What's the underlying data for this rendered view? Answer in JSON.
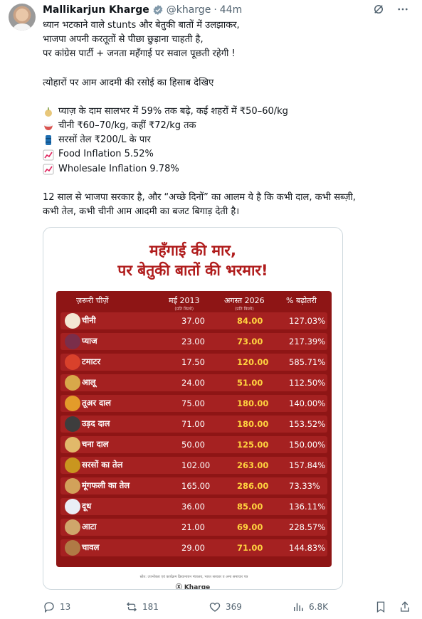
{
  "author": {
    "name": "Mallikarjun Kharge",
    "handle": "@kharge",
    "dot": "·",
    "time": "44m"
  },
  "text": {
    "l1": "ध्यान भटकाने वाले stunts और बेतुकी बातों में उलझाकर,",
    "l2": "भाजपा अपनी करतूतों से पीछा छुड़ाना चाहती है,",
    "l3": "पर कांग्रेस पार्टी + जनता महँगाई पर सवाल पूछती रहेगी !",
    "l4": "त्योहारों पर आम आदमी की रसोई का हिसाब देखिए",
    "b1": "प्याज़ के दाम सालभर में 59% तक बढ़े, कई शहरों में ₹50–60/kg",
    "b2": "चीनी ₹60–70/kg, कहीं ₹72/kg तक",
    "b3": "सरसों तेल ₹200/L के पार",
    "b4": "Food Inflation 5.52%",
    "b5": "Wholesale Inflation 9.78%",
    "l5": "12 साल से भाजपा सरकार है, और “अच्छे दिनों” का आलम ये है कि कभी दाल, कभी सब्ज़ी,",
    "l6": "कभी तेल, कभी चीनी आम आदमी का बजट बिगाड़ देती है।"
  },
  "poster": {
    "title1": "महँगाई की मार,",
    "title2": "पर बेतुकी बातों की भरमार!",
    "headers": {
      "item": "ज़रूरी चीज़ें",
      "may2013": "मई 2013",
      "aug2026": "अगस्त 2026",
      "sub": "(प्रति किलो)",
      "increase": "% बढ़ोतरी"
    },
    "rows": [
      {
        "item": "चीनी",
        "a": "37.00",
        "b": "84.00",
        "c": "127.03%"
      },
      {
        "item": "प्याज",
        "a": "23.00",
        "b": "73.00",
        "c": "217.39%"
      },
      {
        "item": "टमाटर",
        "a": "17.50",
        "b": "120.00",
        "c": "585.71%"
      },
      {
        "item": "आलू",
        "a": "24.00",
        "b": "51.00",
        "c": "112.50%"
      },
      {
        "item": "तूअर दाल",
        "a": "75.00",
        "b": "180.00",
        "c": "140.00%"
      },
      {
        "item": "उड़द दाल",
        "a": "71.00",
        "b": "180.00",
        "c": "153.52%"
      },
      {
        "item": "चना दाल",
        "a": "50.00",
        "b": "125.00",
        "c": "150.00%"
      },
      {
        "item": "सरसों का तेल",
        "a": "102.00",
        "b": "263.00",
        "c": "157.84%"
      },
      {
        "item": "मूंगफली का तेल",
        "a": "165.00",
        "b": "286.00",
        "c": "73.33%"
      },
      {
        "item": "दूध",
        "a": "36.00",
        "b": "85.00",
        "c": "136.11%"
      },
      {
        "item": "आटा",
        "a": "21.00",
        "b": "69.00",
        "c": "228.57%"
      },
      {
        "item": "चावल",
        "a": "29.00",
        "b": "71.00",
        "c": "144.83%"
      }
    ],
    "source": "स्रोत: उपभोक्ता एवं कार्यक्रम क्रियान्वयन मंत्रालय, भारत सरकार व अन्य समाचार पत्र",
    "brand": "Ⓧ Kharge"
  },
  "actions": {
    "replies": "13",
    "reposts": "181",
    "likes": "369",
    "views": "6.8K"
  },
  "colors": {
    "accent": "#1d9bf0",
    "poster_red": "#8e1515",
    "title_red": "#b01c1c",
    "highlight": "#ffd23f"
  }
}
